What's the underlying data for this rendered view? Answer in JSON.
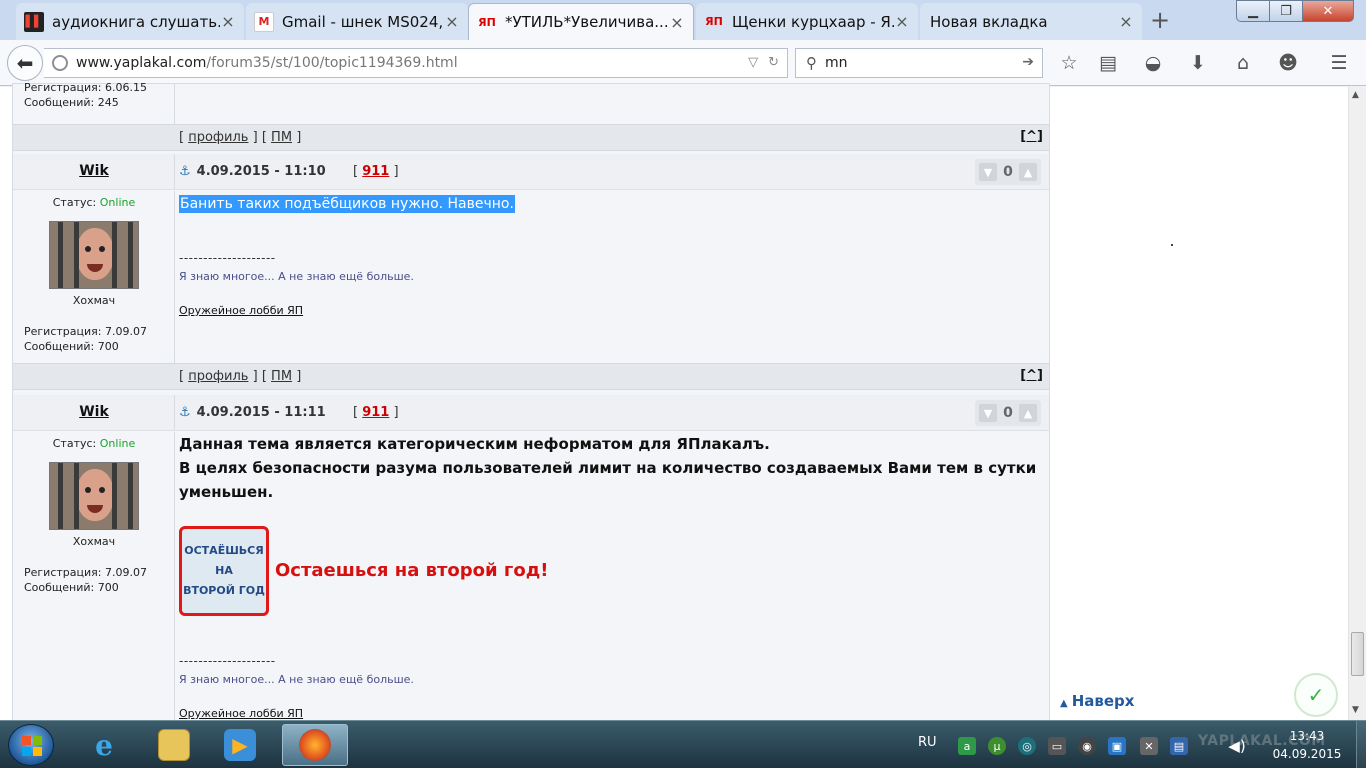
{
  "browser": {
    "tabs": [
      {
        "label": "аудиокнига слушать...",
        "icon": "audiobook-icon"
      },
      {
        "label": "Gmail - шнек MS024,...",
        "icon": "gmail-icon"
      },
      {
        "label": "*УТИЛЬ*Увеличива...",
        "icon": "yap-icon"
      },
      {
        "label": "Щенки курцхаар - Я...",
        "icon": "yap-icon"
      },
      {
        "label": "Новая вкладка",
        "icon": ""
      }
    ],
    "url_host": "www.yaplakal.com",
    "url_path": "/forum35/st/100/topic1194369.html",
    "search_value": "mn"
  },
  "forum": {
    "prev_post": {
      "reg": "Регистрация: 6.06.15",
      "messages": "Сообщений: 245"
    },
    "actions": {
      "open_bracket": "[",
      "close_bracket": "]",
      "profile": "профиль",
      "pm": "ПМ",
      "to_top": "[^]"
    },
    "posts": [
      {
        "author": "Wik",
        "date": "4.09.2015 - 11:10",
        "post_number": "911",
        "rating": "0",
        "status_label": "Статус:",
        "status_value": "Online",
        "user_title": "Хохмач",
        "reg": "Регистрация: 7.09.07",
        "messages": "Сообщений: 700",
        "text": "Банить таких подъёбщиков нужно. Навечно.",
        "separator": "--------------------",
        "signature": "Я знаю многое... А не знаю ещё больше.",
        "signature_link": "Оружейное лобби ЯП"
      },
      {
        "author": "Wik",
        "date": "4.09.2015 - 11:11",
        "post_number": "911",
        "rating": "0",
        "status_label": "Статус:",
        "status_value": "Online",
        "user_title": "Хохмач",
        "reg": "Регистрация: 7.09.07",
        "messages": "Сообщений: 700",
        "text_line1": "Данная тема является категорическим неформатом для ЯПлакалъ.",
        "text_line2": "В целях безопасности разума пользователей лимит на количество создаваемых Вами тем в сутки уменьшен.",
        "badge_lines": [
          "ОСТАЁШЬСЯ",
          "НА",
          "ВТОРОЙ ГОД"
        ],
        "badge_caption": "Остаешься на второй год!",
        "separator": "--------------------",
        "signature": "Я знаю многое... А не знаю ещё больше.",
        "signature_link": "Оружейное лобби ЯП"
      }
    ]
  },
  "sidebar": {
    "to_top_label": "Наверх"
  },
  "taskbar": {
    "language": "RU",
    "time": "13:43",
    "date": "04.09.2015",
    "watermark": "YAPLAKAL.COM"
  },
  "colors": {
    "online": "#1aa32a",
    "selection": "#3399ff",
    "badge_red": "#d60f0f"
  }
}
